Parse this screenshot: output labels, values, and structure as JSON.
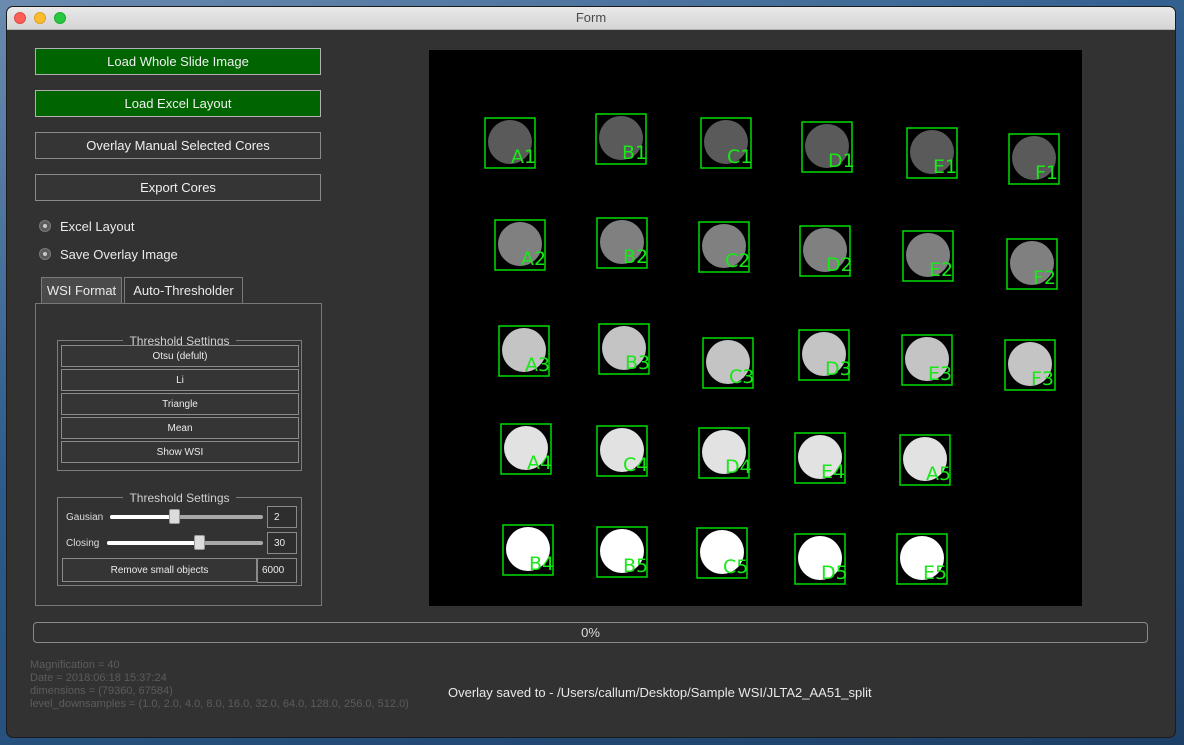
{
  "window": {
    "title": "Form"
  },
  "buttons": {
    "load_wsi": "Load Whole Slide Image",
    "load_excel": "Load Excel Layout",
    "overlay_manual": "Overlay Manual Selected Cores",
    "export_cores": "Export Cores"
  },
  "radios": {
    "excel_layout": "Excel Layout",
    "save_overlay": "Save Overlay Image"
  },
  "tabs": {
    "wsi_format": "WSI Format",
    "auto_thresholder": "Auto-Thresholder"
  },
  "threshold_methods": {
    "title": "Threshold Settings",
    "otsu": "Otsu (defult)",
    "li": "Li",
    "triangle": "Triangle",
    "mean": "Mean",
    "show_wsi": "Show WSI"
  },
  "threshold_params": {
    "title": "Threshold Settings",
    "gausian_label": "Gausian",
    "gausian_value": "2",
    "gausian_fraction": 0.42,
    "closing_label": "Closing",
    "closing_value": "30",
    "closing_fraction": 0.59,
    "remove_small_label": "Remove small objects",
    "remove_small_value": "6000"
  },
  "cores": {
    "label_color": "#18e818",
    "box_color": "#00dd00",
    "items": [
      {
        "label": "A1",
        "shade": "#5a5a5a"
      },
      {
        "label": "B1",
        "shade": "#5a5a5a"
      },
      {
        "label": "C1",
        "shade": "#5a5a5a"
      },
      {
        "label": "D1",
        "shade": "#5a5a5a"
      },
      {
        "label": "E1",
        "shade": "#5a5a5a"
      },
      {
        "label": "F1",
        "shade": "#5a5a5a"
      },
      {
        "label": "A2",
        "shade": "#808080"
      },
      {
        "label": "B2",
        "shade": "#808080"
      },
      {
        "label": "C2",
        "shade": "#808080"
      },
      {
        "label": "D2",
        "shade": "#808080"
      },
      {
        "label": "E2",
        "shade": "#808080"
      },
      {
        "label": "F2",
        "shade": "#808080"
      },
      {
        "label": "A3",
        "shade": "#c4c4c4"
      },
      {
        "label": "B3",
        "shade": "#c4c4c4"
      },
      {
        "label": "C3",
        "shade": "#c4c4c4"
      },
      {
        "label": "D3",
        "shade": "#c4c4c4"
      },
      {
        "label": "E3",
        "shade": "#c4c4c4"
      },
      {
        "label": "F3",
        "shade": "#c4c4c4"
      },
      {
        "label": "A4",
        "shade": "#e2e2e2"
      },
      {
        "label": "C4",
        "shade": "#e2e2e2"
      },
      {
        "label": "D4",
        "shade": "#e2e2e2"
      },
      {
        "label": "E4",
        "shade": "#e2e2e2"
      },
      {
        "label": "A5",
        "shade": "#e2e2e2"
      },
      {
        "label": "B4",
        "shade": "#ffffff"
      },
      {
        "label": "B5",
        "shade": "#ffffff"
      },
      {
        "label": "C5",
        "shade": "#ffffff"
      },
      {
        "label": "D5",
        "shade": "#ffffff"
      },
      {
        "label": "E5",
        "shade": "#ffffff"
      }
    ]
  },
  "progress": {
    "text": "0%",
    "value": 0
  },
  "info": {
    "magnification": "Magnification = 40",
    "date": "Date = 2018:06:18 15:37:24",
    "dimensions": "dimensions = (79360, 67584)",
    "downsamples": "level_downsamples = (1.0, 2.0, 4.0, 8.0, 16.0, 32.0, 64.0, 128.0, 256.0, 512.0)"
  },
  "status": "Overlay saved to - /Users/callum/Desktop/Sample WSI/JLTA2_AA51_split"
}
